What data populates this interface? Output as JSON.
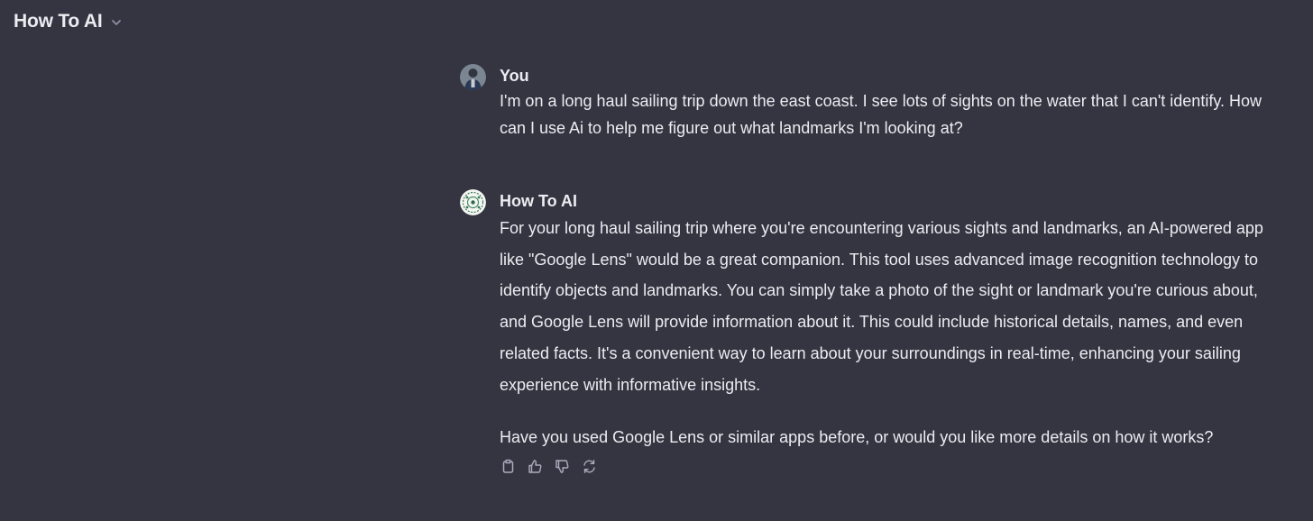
{
  "header": {
    "title": "How To AI"
  },
  "messages": [
    {
      "author": "You",
      "text": "I'm on a long haul sailing trip down the east coast. I see lots of sights on the water that I can't identify. How can I use Ai to help me figure out what landmarks I'm looking at?"
    },
    {
      "author": "How To AI",
      "paragraphs": [
        "For your long haul sailing trip where you're encountering various sights and landmarks, an AI-powered app like \"Google Lens\" would be a great companion. This tool uses advanced image recognition technology to identify objects and landmarks. You can simply take a photo of the sight or landmark you're curious about, and Google Lens will provide information about it. This could include historical details, names, and even related facts. It's a convenient way to learn about your surroundings in real-time, enhancing your sailing experience with informative insights.",
        "Have you used Google Lens or similar apps before, or would you like more details on how it works?"
      ]
    }
  ],
  "actions": {
    "icons": [
      "clipboard-icon",
      "thumbs-up-icon",
      "thumbs-down-icon",
      "regenerate-icon"
    ]
  }
}
